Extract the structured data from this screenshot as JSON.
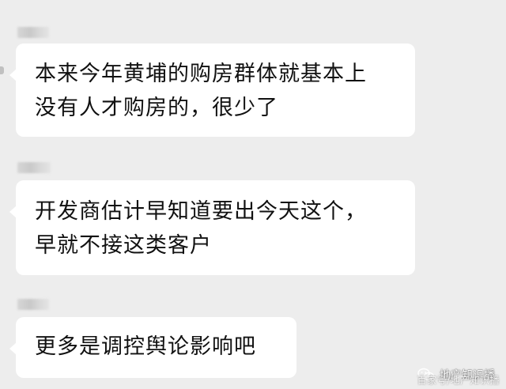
{
  "messages": [
    {
      "sender": "",
      "lines": [
        "本来今年黄埔的购房群体就基本上",
        "没有人才购房的，很少了"
      ]
    },
    {
      "sender": "",
      "lines": [
        "开发商估计早知道要出今天这个，",
        "早就不接这类客户"
      ]
    },
    {
      "sender": "",
      "lines": [
        "更多是调控舆论影响吧"
      ]
    }
  ],
  "watermark": {
    "icon": "wechat-icon",
    "account": "地产知识播",
    "source": "百家号/地产知识播"
  }
}
